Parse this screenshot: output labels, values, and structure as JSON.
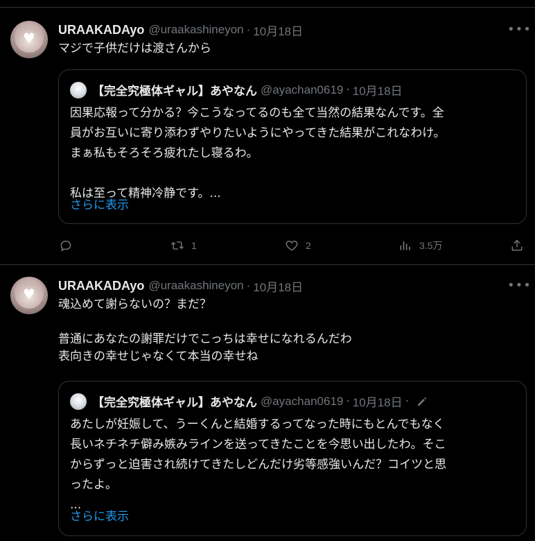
{
  "tweets": [
    {
      "name": "URAAKADAyo",
      "handle": "@uraakashineyon",
      "dot": "·",
      "date": "10月18日",
      "text": "マジで子供だけは渡さんから",
      "quote": {
        "name": "【完全究極体ギャル】あやなん",
        "handle": "@ayachan0619",
        "dot": "·",
        "date": "10月18日",
        "text": "因果応報って分かる？今こうなってるのも全て当然の結果なんです。全\n員がお互いに寄り添わずやりたいようにやってきた結果がこれなわけ。\nまぁ私もそろそろ疲れたし寝るわ。\n\n私は至って精神冷静です。...",
        "show_more": "さらに表示"
      },
      "actions": {
        "replies": "",
        "retweets": "1",
        "likes": "2",
        "views": "3.5万"
      }
    },
    {
      "name": "URAAKADAyo",
      "handle": "@uraakashineyon",
      "dot": "·",
      "date": "10月18日",
      "text": "魂込めて謝らないの？まだ？\n\n普通にあなたの謝罪だけでこっちは幸せになれるんだわ\n表向きの幸せじゃなくて本当の幸せね",
      "quote": {
        "name": "【完全究極体ギャル】あやなん",
        "handle": "@ayachan0619",
        "dot": "·",
        "date": "10月18日",
        "text": "あたしが妊娠して、うーくんと結婚するってなった時にもとんでもなく\n長いネチネチ僻み嫉みラインを送ってきたことを今思い出したわ。そこ\nからずっと迫害され続けてきたしどんだけ劣等感強いんだ？コイツと思\nったよ。\n...",
        "show_more": "さらに表示"
      }
    }
  ],
  "icons": {
    "more": "more-horizontal-icon",
    "reply": "reply-icon",
    "retweet": "retweet-icon",
    "like": "heart-icon",
    "views": "views-icon",
    "share": "share-icon",
    "edit": "edit-icon"
  },
  "colors": {
    "background": "#000000",
    "text": "#e7e9ea",
    "secondary": "#71767b",
    "link": "#1d9bf0",
    "border": "#2f3336"
  }
}
